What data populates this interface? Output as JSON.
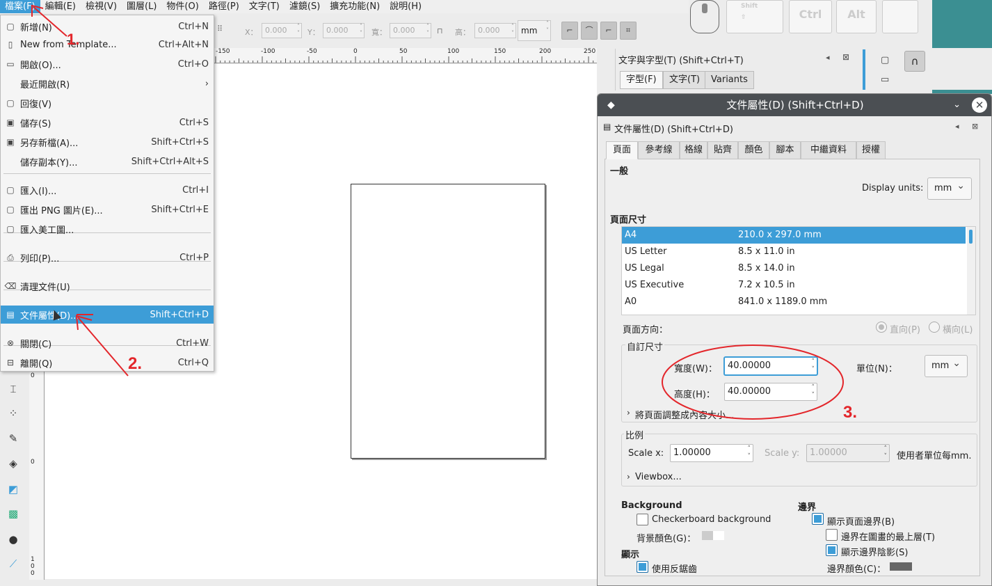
{
  "menubar": [
    "檔案(F)",
    "編輯(E)",
    "檢視(V)",
    "圖層(L)",
    "物件(O)",
    "路徑(P)",
    "文字(T)",
    "濾鏡(S)",
    "擴充功能(N)",
    "說明(H)"
  ],
  "toolbar": {
    "x_label": "X：",
    "x_value": "0.000",
    "y_label": "Y：",
    "y_value": "0.000",
    "w_label": "寬：",
    "w_value": "0.000",
    "h_label": "高：",
    "h_value": "0.000",
    "unit": "mm"
  },
  "ruler_labels": [
    "-150",
    "-100",
    "-50",
    "0",
    "50",
    "100",
    "150",
    "200",
    "250"
  ],
  "vruler_labels": [
    "0",
    "0",
    "1",
    "0",
    "0"
  ],
  "file_menu": [
    {
      "icon": "new-doc-icon",
      "glyph": "▢",
      "label": "新增(N)",
      "shortcut": "Ctrl+N"
    },
    {
      "icon": "template-icon",
      "glyph": "▯",
      "label": "New from Template...",
      "shortcut": "Ctrl+Alt+N"
    },
    {
      "icon": "open-folder-icon",
      "glyph": "▭",
      "label": "開啟(O)...",
      "shortcut": "Ctrl+O"
    },
    {
      "icon": "",
      "glyph": "",
      "label": "最近開啟(R)",
      "shortcut": "›"
    },
    {
      "icon": "revert-icon",
      "glyph": "▢",
      "label": "回復(V)",
      "shortcut": ""
    },
    {
      "icon": "save-icon",
      "glyph": "▣",
      "label": "儲存(S)",
      "shortcut": "Ctrl+S"
    },
    {
      "icon": "save-as-icon",
      "glyph": "▣",
      "label": "另存新檔(A)...",
      "shortcut": "Shift+Ctrl+S"
    },
    {
      "icon": "",
      "glyph": "",
      "label": "儲存副本(Y)...",
      "shortcut": "Shift+Ctrl+Alt+S"
    },
    {
      "icon": "import-icon",
      "glyph": "▢",
      "label": "匯入(I)...",
      "shortcut": "Ctrl+I"
    },
    {
      "icon": "export-png-icon",
      "glyph": "▢",
      "label": "匯出 PNG 圖片(E)...",
      "shortcut": "Shift+Ctrl+E"
    },
    {
      "icon": "import-clipart-icon",
      "glyph": "▢",
      "label": "匯入美工圖...",
      "shortcut": ""
    },
    {
      "icon": "print-icon",
      "glyph": "⎙",
      "label": "列印(P)...",
      "shortcut": "Ctrl+P"
    },
    {
      "icon": "cleanup-icon",
      "glyph": "⌫",
      "label": "清理文件(U)",
      "shortcut": ""
    },
    {
      "icon": "document-properties-icon",
      "glyph": "▤",
      "label": "文件屬性(D)...",
      "shortcut": "Shift+Ctrl+D"
    },
    {
      "icon": "close-icon",
      "glyph": "⊗",
      "label": "關閉(C)",
      "shortcut": "Ctrl+W"
    },
    {
      "icon": "quit-icon",
      "glyph": "⊟",
      "label": "離開(Q)",
      "shortcut": "Ctrl+Q"
    }
  ],
  "keyboard": {
    "shift": "Shift",
    "ctrl": "Ctrl",
    "alt": "Alt"
  },
  "text_panel": {
    "title": "文字與字型(T) (Shift+Ctrl+T)",
    "tabs": [
      "字型(F)",
      "文字(T)",
      "Variants"
    ]
  },
  "dialog": {
    "title": "文件屬性(D) (Shift+Ctrl+D)",
    "subtitle": "文件屬性(D) (Shift+Ctrl+D)",
    "tabs": [
      "頁面",
      "參考線",
      "格線",
      "貼齊",
      "顏色",
      "腳本",
      "中繼資料",
      "授權"
    ],
    "general": "一般",
    "display_units_label": "Display units:",
    "display_units": "mm",
    "page_size_label": "頁面尺寸",
    "page_sizes": [
      {
        "name": "A4",
        "size": "210.0 x 297.0 mm"
      },
      {
        "name": "US Letter",
        "size": "8.5 x 11.0 in"
      },
      {
        "name": "US Legal",
        "size": "8.5 x 14.0 in"
      },
      {
        "name": "US Executive",
        "size": "7.2 x 10.5 in"
      },
      {
        "name": "A0",
        "size": "841.0 x 1189.0 mm"
      }
    ],
    "orientation_label": "頁面方向：",
    "portrait": "直向(P)",
    "landscape": "橫向(L)",
    "custom_size_label": "自訂尺寸",
    "width_label": "寬度(W)：",
    "width_value": "40.00000",
    "height_label": "高度(H)：",
    "height_value": "40.00000",
    "units_label": "單位(N)：",
    "units": "mm",
    "resize_to_content": "將頁面調整成內容大小...",
    "scale_label": "比例",
    "scale_x_label": "Scale x:",
    "scale_x": "1.00000",
    "scale_y_label": "Scale y:",
    "scale_y": "1.00000",
    "user_units": "使用者單位每mm.",
    "viewbox": "Viewbox...",
    "background_label": "Background",
    "checkerboard": "Checkerboard background",
    "bg_color_label": "背景顏色(G)：",
    "display_label": "顯示",
    "antialias": "使用反鋸齒",
    "border_label": "邊界",
    "show_border": "顯示頁面邊界(B)",
    "border_on_top": "邊界在圖畫的最上層(T)",
    "border_shadow": "顯示邊界陰影(S)",
    "border_color_label": "邊界顏色(C)："
  },
  "annotations": {
    "step1": "1.",
    "step2": "2.",
    "step3": "3."
  },
  "colors": {
    "accent": "#3d9dd7",
    "annotation": "#e3262b",
    "title_bar": "#4b4f53"
  }
}
